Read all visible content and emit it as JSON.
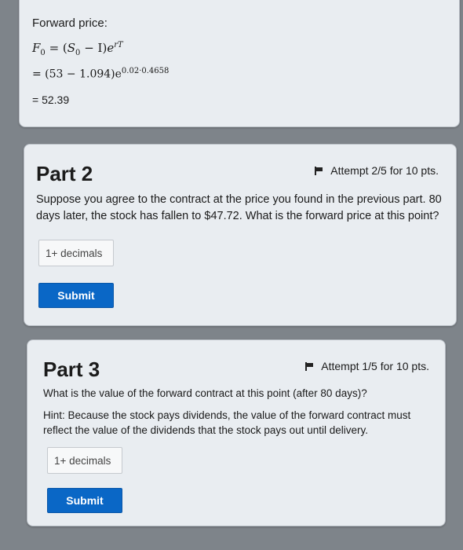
{
  "forward_price_section": {
    "label": "Forward price:",
    "formula_lhs": "F",
    "formula_lhs_sub": "0",
    "formula_rhs_open": " = (",
    "formula_s": "S",
    "formula_s_sub": "0",
    "formula_minus_i": " − I)",
    "formula_e": "e",
    "formula_exp": "rT",
    "substitution": "= (53 − 1.094)e",
    "substitution_exp": "0.02·0.4658",
    "result": "= 52.39"
  },
  "part2": {
    "title": "Part 2",
    "attempt": "Attempt 2/5 for 10 pts.",
    "question": "Suppose you agree to the contract at the price you found in the previous part. 80 days later, the stock has fallen to $47.72. What is the forward price at this point?",
    "answer_placeholder": "1+ decimals",
    "submit_label": "Submit"
  },
  "part3": {
    "title": "Part 3",
    "attempt": "Attempt 1/5 for 10 pts.",
    "question": "What is the value of the forward contract at this point (after 80 days)?",
    "hint": "Hint: Because the stock pays dividends, the value of the forward contract must reflect the value of the dividends that the stock pays out until delivery.",
    "answer_placeholder": "1+ decimals",
    "submit_label": "Submit"
  }
}
